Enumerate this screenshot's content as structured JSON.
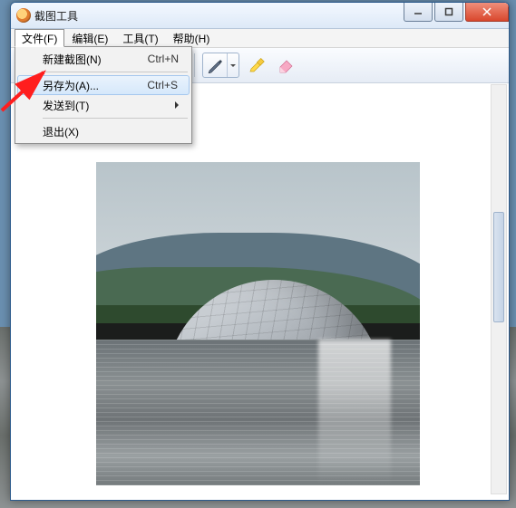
{
  "window": {
    "title": "截图工具"
  },
  "menu": {
    "file": "文件(F)",
    "edit": "编辑(E)",
    "tools": "工具(T)",
    "help": "帮助(H)"
  },
  "file_menu": {
    "new_snip": {
      "label": "新建截图(N)",
      "shortcut": "Ctrl+N"
    },
    "save_as": {
      "label": "另存为(A)...",
      "shortcut": "Ctrl+S"
    },
    "send_to": {
      "label": "发送到(T)"
    },
    "exit": {
      "label": "退出(X)"
    }
  },
  "icons": {
    "pen": "pen-icon",
    "highlighter": "highlighter-icon",
    "eraser": "eraser-icon"
  }
}
